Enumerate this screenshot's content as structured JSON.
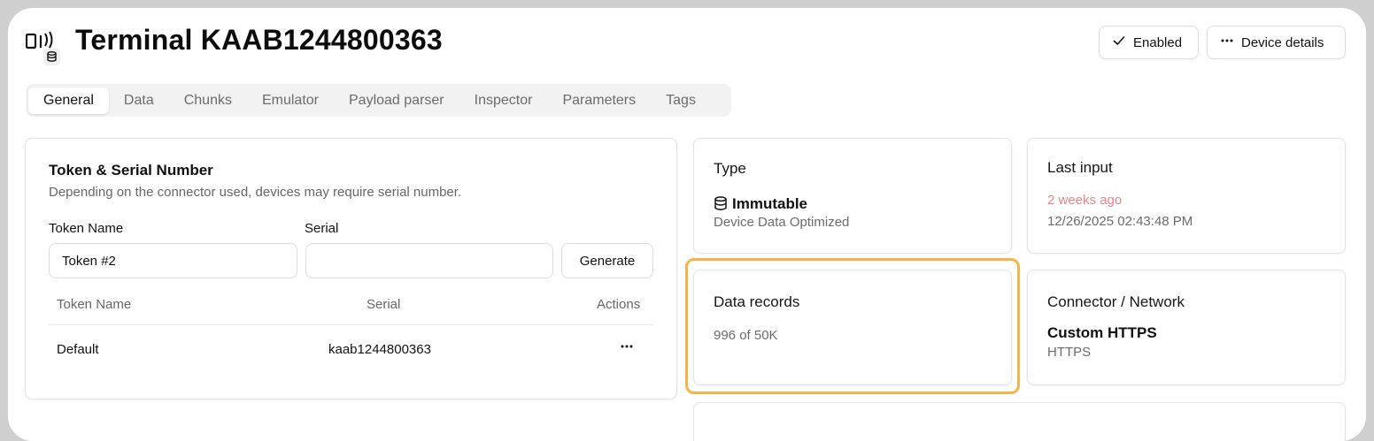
{
  "header": {
    "title": "Terminal KAAB1244800363",
    "enabled_label": "Enabled",
    "details_label": "Device details"
  },
  "tabs": [
    {
      "label": "General",
      "active": true
    },
    {
      "label": "Data",
      "active": false
    },
    {
      "label": "Chunks",
      "active": false
    },
    {
      "label": "Emulator",
      "active": false
    },
    {
      "label": "Payload parser",
      "active": false
    },
    {
      "label": "Inspector",
      "active": false
    },
    {
      "label": "Parameters",
      "active": false
    },
    {
      "label": "Tags",
      "active": false
    }
  ],
  "token_card": {
    "title": "Token & Serial Number",
    "description": "Depending on the connector used, devices may require serial number.",
    "token_name_label": "Token Name",
    "serial_label": "Serial",
    "token_name_value": "Token #2",
    "serial_value": "",
    "generate_label": "Generate",
    "table": {
      "columns": [
        "Token Name",
        "Serial",
        "Actions"
      ],
      "rows": [
        {
          "token_name": "Default",
          "serial": "kaab1244800363"
        }
      ]
    }
  },
  "type_card": {
    "label": "Type",
    "value": "Immutable",
    "sub": "Device Data Optimized"
  },
  "last_input_card": {
    "label": "Last input",
    "relative": "2 weeks ago",
    "timestamp": "12/26/2025 02:43:48 PM"
  },
  "data_records_card": {
    "label": "Data records",
    "value": "996 of 50K"
  },
  "connector_card": {
    "label": "Connector / Network",
    "value": "Custom HTTPS",
    "sub": "HTTPS"
  },
  "colors": {
    "highlight": "#f7b24a",
    "relative_time": "#e8858a",
    "muted": "#6b6b6b"
  }
}
